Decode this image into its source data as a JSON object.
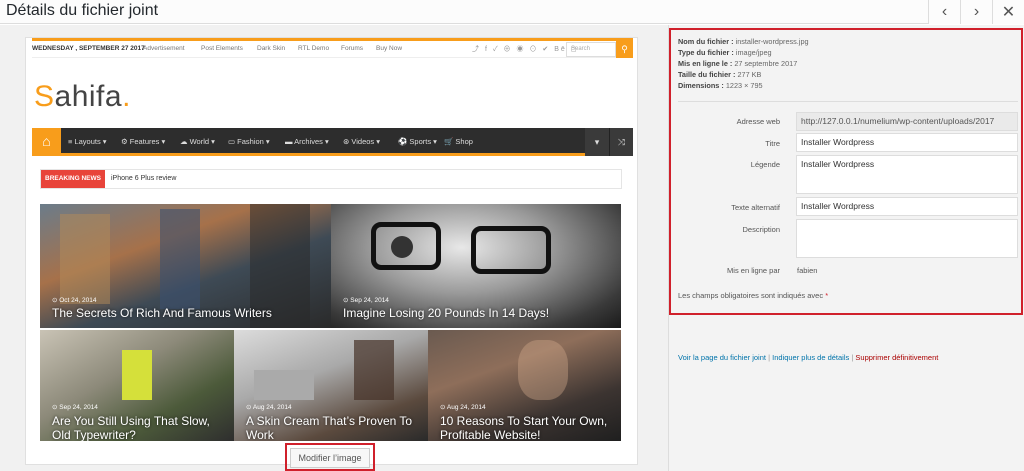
{
  "header": {
    "title": "Détails du fichier joint",
    "prev_icon": "chevron-left-icon",
    "next_icon": "chevron-right-icon",
    "close_icon": "close-icon"
  },
  "preview": {
    "topbar": {
      "date": "WEDNESDAY , SEPTEMBER 27 2017",
      "links": [
        "Advertisement",
        "Post Elements",
        "Dark Skin",
        "RTL Demo",
        "Forums",
        "Buy Now"
      ],
      "social_icons": "⤴ f ✓ ⊕ ◉ ⊙ ✔ Bē ◻",
      "search_placeholder": "Search"
    },
    "logo": {
      "first": "S",
      "rest": "ahifa",
      "dot": "."
    },
    "nav": {
      "items": [
        "≡ Layouts ▾",
        "⚙ Features ▾",
        "☁ World ▾",
        "▭ Fashion ▾",
        "▬ Archives ▾",
        "⊛ Videos ▾",
        "⚽ Sports ▾",
        "🛒 Shop"
      ]
    },
    "breaking": {
      "tag": "BREAKING NEWS",
      "headline": "iPhone 6 Plus review"
    },
    "tiles": [
      {
        "date": "⊙ Oct 24, 2014",
        "title": "The Secrets Of Rich And Famous Writers"
      },
      {
        "date": "⊙ Sep 24, 2014",
        "title": "Imagine Losing 20 Pounds In 14 Days!"
      },
      {
        "date": "⊙ Sep 24, 2014",
        "title": "Are You Still Using That Slow,",
        "title2": "Old Typewriter?"
      },
      {
        "date": "⊙ Aug 24, 2014",
        "title": "A Skin Cream That’s Proven To",
        "title2": "Work"
      },
      {
        "date": "⊙ Aug 24, 2014",
        "title": "10 Reasons To Start Your Own,",
        "title2": "Profitable Website!"
      }
    ],
    "modify_button": "Modifier l’image"
  },
  "details": {
    "filename_label": "Nom du fichier :",
    "filename": "installer-wordpress.jpg",
    "filetype_label": "Type du fichier :",
    "filetype": "image/jpeg",
    "uploaded_label": "Mis en ligne le :",
    "uploaded": "27 septembre 2017",
    "filesize_label": "Taille du fichier :",
    "filesize": "277 KB",
    "dimensions_label": "Dimensions :",
    "dimensions": "1223 × 795"
  },
  "form": {
    "url_label": "Adresse web",
    "url_value": "http://127.0.0.1/numelium/wp-content/uploads/2017",
    "title_label": "Titre",
    "title_value": "Installer Wordpress",
    "caption_label": "Légende",
    "caption_value": "Installer Wordpress",
    "alt_label": "Texte alternatif",
    "alt_value": "Installer Wordpress",
    "description_label": "Description",
    "description_value": "",
    "uploadedby_label": "Mis en ligne par",
    "uploadedby_value": "fabien",
    "required_note": "Les champs obligatoires sont indiqués avec",
    "required_star": "*"
  },
  "links": {
    "view": "Voir la page du fichier joint",
    "edit": "Indiquer plus de détails",
    "delete": "Supprimer définitivement",
    "separator": "|"
  },
  "colors": {
    "accent": "#f89d1b",
    "highlight": "#d0202b",
    "link": "#0073aa",
    "delete": "#aa0000"
  }
}
